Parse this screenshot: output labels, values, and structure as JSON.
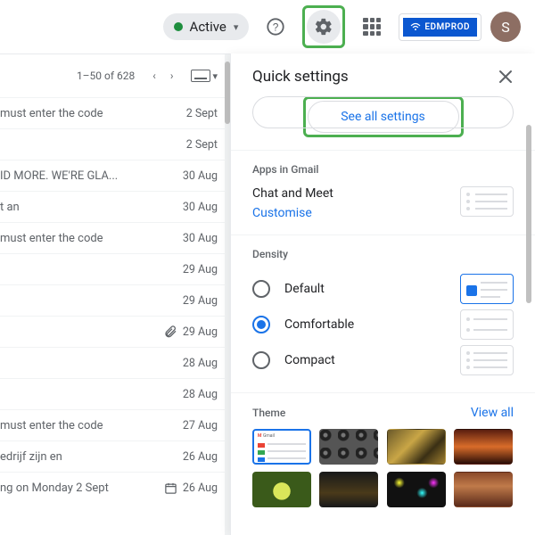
{
  "topbar": {
    "status_label": "Active",
    "logo_text": "EDMPROD",
    "avatar_initial": "S"
  },
  "list": {
    "range_label": "1–50 of 628",
    "rows": [
      {
        "subject": "must enter the code",
        "date": "2 Sept",
        "icon": ""
      },
      {
        "subject": "",
        "date": "2 Sept",
        "icon": ""
      },
      {
        "subject": "ID MORE. WE'RE GLA...",
        "date": "30 Aug",
        "icon": ""
      },
      {
        "subject": "t an",
        "date": "30 Aug",
        "icon": ""
      },
      {
        "subject": "must enter the code",
        "date": "30 Aug",
        "icon": ""
      },
      {
        "subject": "",
        "date": "29 Aug",
        "icon": ""
      },
      {
        "subject": "",
        "date": "29 Aug",
        "icon": ""
      },
      {
        "subject": "",
        "date": "29 Aug",
        "icon": "attach"
      },
      {
        "subject": "",
        "date": "28 Aug",
        "icon": ""
      },
      {
        "subject": "",
        "date": "28 Aug",
        "icon": ""
      },
      {
        "subject": "must enter the code",
        "date": "27 Aug",
        "icon": ""
      },
      {
        "subject": "edrijf zijn en",
        "date": "26 Aug",
        "icon": ""
      },
      {
        "subject": "ng on Monday 2 Sept",
        "date": "26 Aug",
        "icon": "event"
      }
    ]
  },
  "panel": {
    "title": "Quick settings",
    "see_all_label": "See all settings",
    "apps_section_title": "Apps in Gmail",
    "apps_subtitle": "Chat and Meet",
    "customise_label": "Customise",
    "density_section_title": "Density",
    "density_options": [
      {
        "label": "Default",
        "selected": false
      },
      {
        "label": "Comfortable",
        "selected": true
      },
      {
        "label": "Compact",
        "selected": false
      }
    ],
    "theme_section_title": "Theme",
    "view_all_label": "View all"
  }
}
